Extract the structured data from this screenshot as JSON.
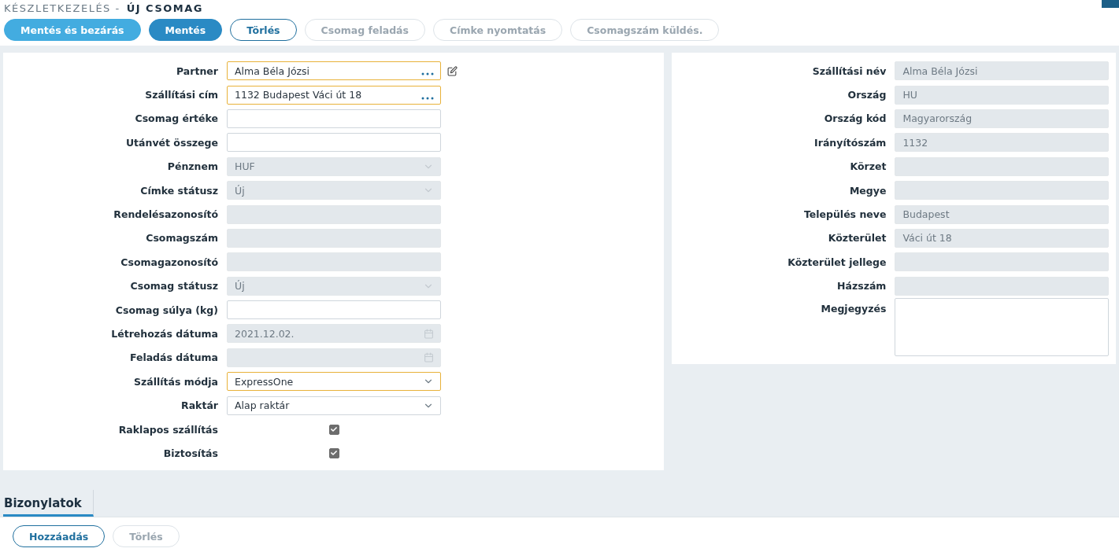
{
  "breadcrumb": {
    "section": "KÉSZLETKEZELÉS -",
    "title": "ÚJ CSOMAG"
  },
  "toolbar": [
    {
      "label": "Mentés és bezárás",
      "kind": "light",
      "disabled": false
    },
    {
      "label": "Mentés",
      "kind": "filled",
      "disabled": false
    },
    {
      "label": "Törlés",
      "kind": "outline",
      "disabled": false
    },
    {
      "label": "Csomag feladás",
      "kind": "outline",
      "disabled": true
    },
    {
      "label": "Címke nyomtatás",
      "kind": "outline",
      "disabled": true
    },
    {
      "label": "Csomagszám küldés.",
      "kind": "outline",
      "disabled": true
    }
  ],
  "left_form": [
    {
      "label": "Partner",
      "kind": "lookup",
      "value": "Alma Béla Józsi",
      "disabled": false,
      "highlighted": true,
      "editable": true
    },
    {
      "label": "Szállítási cím",
      "kind": "lookup",
      "value": "1132 Budapest Váci út 18",
      "disabled": false,
      "highlighted": true
    },
    {
      "label": "Csomag értéke",
      "kind": "text",
      "disabled": false,
      "highlighted": false
    },
    {
      "label": "Utánvét összege",
      "kind": "text",
      "disabled": false,
      "highlighted": false
    },
    {
      "label": "Pénznem",
      "kind": "select",
      "value": "HUF",
      "disabled": true,
      "highlighted": false
    },
    {
      "label": "Címke státusz",
      "kind": "select",
      "value": "Új",
      "disabled": true,
      "highlighted": false
    },
    {
      "label": "Rendelésazonosító",
      "kind": "text",
      "disabled": true,
      "highlighted": false
    },
    {
      "label": "Csomagszám",
      "kind": "text",
      "disabled": true,
      "highlighted": false
    },
    {
      "label": "Csomagazonosító",
      "kind": "text",
      "disabled": true,
      "highlighted": false
    },
    {
      "label": "Csomag státusz",
      "kind": "select",
      "value": "Új",
      "disabled": true,
      "highlighted": false
    },
    {
      "label": "Csomag súlya (kg)",
      "kind": "text",
      "disabled": false,
      "highlighted": false
    },
    {
      "label": "Létrehozás dátuma",
      "kind": "date",
      "value": "2021.12.02.",
      "disabled": true,
      "highlighted": false
    },
    {
      "label": "Feladás dátuma",
      "kind": "date",
      "disabled": true,
      "highlighted": false
    },
    {
      "label": "Szállítás módja",
      "kind": "select",
      "value": "ExpressOne",
      "disabled": false,
      "highlighted": true
    },
    {
      "label": "Raktár",
      "kind": "select",
      "value": "Alap raktár",
      "disabled": false,
      "highlighted": false
    },
    {
      "label": "Raklapos szállítás",
      "kind": "checkbox",
      "checked": true
    },
    {
      "label": "Biztosítás",
      "kind": "checkbox",
      "checked": true
    }
  ],
  "right_form": [
    {
      "label": "Szállítási név",
      "kind": "text",
      "value": "Alma Béla Józsi",
      "disabled": true
    },
    {
      "label": "Ország",
      "kind": "text",
      "value": "HU",
      "disabled": true
    },
    {
      "label": "Ország kód",
      "kind": "text",
      "value": "Magyarország",
      "disabled": true
    },
    {
      "label": "Irányítószám",
      "kind": "text",
      "value": "1132",
      "disabled": true
    },
    {
      "label": "Körzet",
      "kind": "text",
      "disabled": true
    },
    {
      "label": "Megye",
      "kind": "text",
      "disabled": true
    },
    {
      "label": "Település neve",
      "kind": "text",
      "value": "Budapest",
      "disabled": true
    },
    {
      "label": "Közterület",
      "kind": "text",
      "value": "Váci út 18",
      "disabled": true
    },
    {
      "label": "Közterület jellege",
      "kind": "text",
      "disabled": true
    },
    {
      "label": "Házszám",
      "kind": "text",
      "disabled": true
    },
    {
      "label": "Megjegyzés",
      "kind": "textarea",
      "disabled": false
    }
  ],
  "tabs": [
    {
      "label": "Bizonylatok",
      "selected": true
    }
  ],
  "tab_toolbar": [
    {
      "label": "Hozzáadás",
      "disabled": false
    },
    {
      "label": "Törlés",
      "disabled": true
    }
  ]
}
